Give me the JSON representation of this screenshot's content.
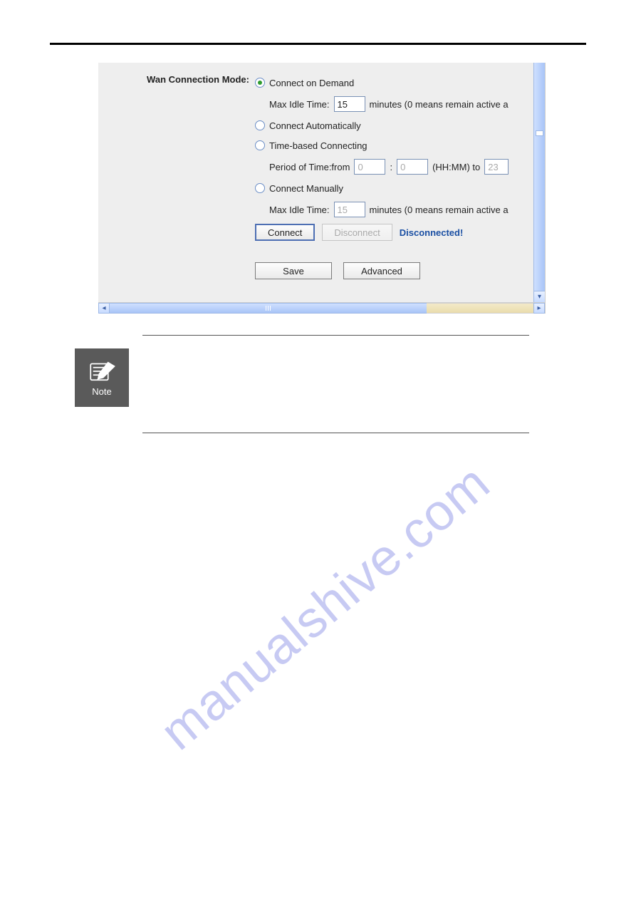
{
  "section_label": "Wan Connection Mode:",
  "options": {
    "demand": {
      "label": "Connect on Demand",
      "idle_label": "Max Idle Time:",
      "idle_value": "15",
      "idle_suffix": "minutes (0 means remain active a"
    },
    "auto": {
      "label": "Connect Automatically"
    },
    "time": {
      "label": "Time-based Connecting",
      "period_prefix": "Period of Time:from",
      "from_value": "0",
      "sep": ":",
      "to_value": "0",
      "hhmm": "(HH:MM) to",
      "end_value": "23"
    },
    "manual": {
      "label": "Connect Manually",
      "idle_label": "Max Idle Time:",
      "idle_value": "15",
      "idle_suffix": "minutes (0 means remain active a"
    }
  },
  "buttons": {
    "connect": "Connect",
    "disconnect": "Disconnect",
    "save": "Save",
    "advanced": "Advanced"
  },
  "status": "Disconnected!",
  "note_label": "Note",
  "watermark": "manualshive.com"
}
